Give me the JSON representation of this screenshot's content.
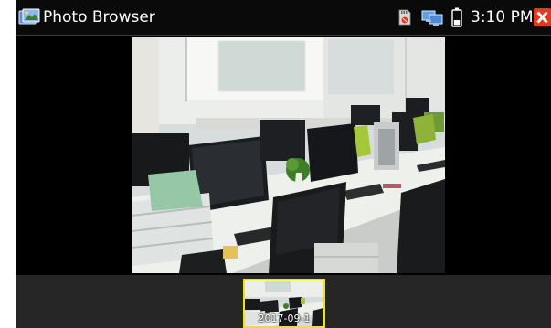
{
  "app": {
    "title": "Photo Browser",
    "icon": "photo-browser-icon"
  },
  "status_bar": {
    "sd_card_icon": "sd-card-icon",
    "network_icon": "computer-network-icon",
    "battery_icon": "battery-icon",
    "time": "3:10 PM",
    "close_icon": "close-icon"
  },
  "viewer": {
    "image_subject": "office-photo"
  },
  "thumbnails": [
    {
      "label": "2017-09-1",
      "selected": true
    }
  ],
  "colors": {
    "selection_border": "#f2e600",
    "close_red": "#e23a1f",
    "strip_background": "#262626"
  }
}
